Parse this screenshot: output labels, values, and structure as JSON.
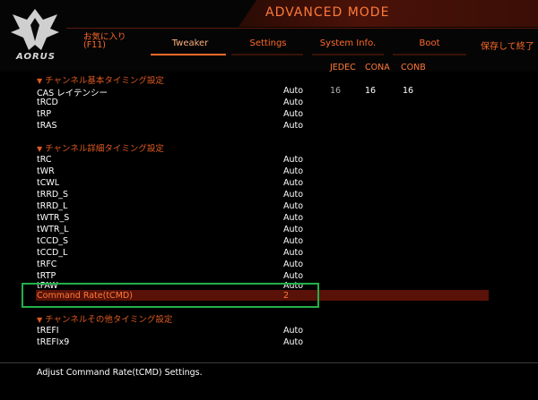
{
  "header": {
    "logo_text": "AORUS",
    "mode_title": "ADVANCED MODE",
    "tabs": [
      {
        "label": "お気に入り"
      },
      {
        "label": "(F11)"
      },
      {
        "label": "Tweaker"
      },
      {
        "label": "Settings"
      },
      {
        "label": "System Info."
      },
      {
        "label": "Boot"
      },
      {
        "label": "保存して終了"
      }
    ],
    "accent_color": "#ff6a2a"
  },
  "columns": {
    "jedec": "JEDEC",
    "cona": "CONA",
    "conb": "CONB"
  },
  "sections": {
    "basic": "チャンネル基本タイミング設定",
    "advanced": "チャンネル詳細タイミング設定",
    "misc": "チャンネルその他タイミング設定"
  },
  "basic_rows": [
    {
      "label": "CAS レイテンシー",
      "value": "Auto",
      "jedec": "16",
      "cona": "16",
      "conb": "16"
    },
    {
      "label": "tRCD",
      "value": "Auto"
    },
    {
      "label": "tRP",
      "value": "Auto"
    },
    {
      "label": "tRAS",
      "value": "Auto"
    }
  ],
  "advanced_rows": [
    {
      "label": "tRC",
      "value": "Auto"
    },
    {
      "label": "tWR",
      "value": "Auto"
    },
    {
      "label": "tCWL",
      "value": "Auto"
    },
    {
      "label": "tRRD_S",
      "value": "Auto"
    },
    {
      "label": "tRRD_L",
      "value": "Auto"
    },
    {
      "label": "tWTR_S",
      "value": "Auto"
    },
    {
      "label": "tWTR_L",
      "value": "Auto"
    },
    {
      "label": "tCCD_S",
      "value": "Auto"
    },
    {
      "label": "tCCD_L",
      "value": "Auto"
    },
    {
      "label": "tRFC",
      "value": "Auto"
    },
    {
      "label": "tRTP",
      "value": "Auto"
    },
    {
      "label": "tFAW",
      "value": "Auto"
    }
  ],
  "selected_row": {
    "label": "Command Rate(tCMD)",
    "value": "2"
  },
  "misc_rows": [
    {
      "label": "tREFI",
      "value": "Auto"
    },
    {
      "label": "tREFIx9",
      "value": "Auto"
    }
  ],
  "help_text": "Adjust Command Rate(tCMD) Settings."
}
